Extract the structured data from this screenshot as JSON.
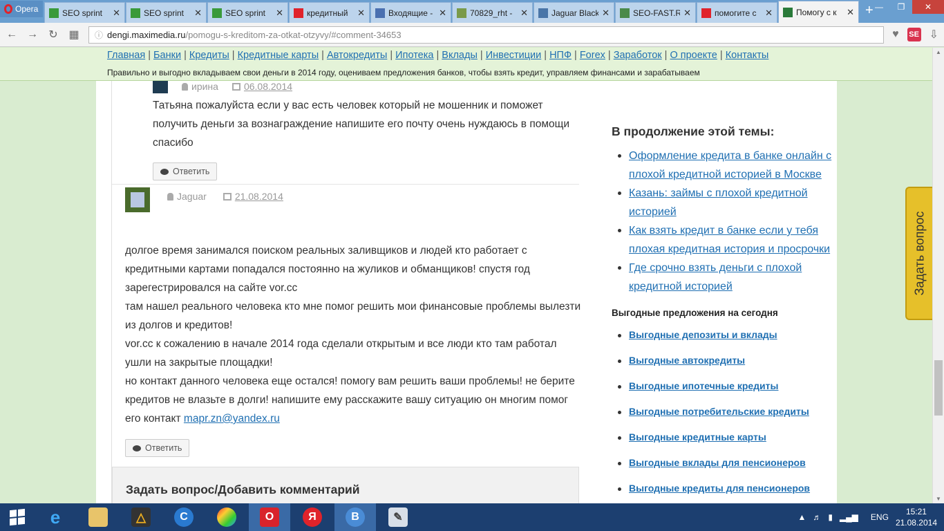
{
  "browser": {
    "menu_label": "Opera",
    "tabs": [
      {
        "title": "SEO sprint",
        "icon": "seosprint-icon",
        "color": "#3a9a3a"
      },
      {
        "title": "SEO sprint",
        "icon": "seosprint-icon",
        "color": "#3a9a3a"
      },
      {
        "title": "SEO sprint",
        "icon": "seosprint-icon",
        "color": "#3a9a3a"
      },
      {
        "title": "кредитный",
        "icon": "yandex-icon",
        "color": "#e0232b"
      },
      {
        "title": "Входящие -",
        "icon": "mail-icon",
        "color": "#4a70b0"
      },
      {
        "title": "70829_rht -",
        "icon": "image-icon",
        "color": "#7a9a4a"
      },
      {
        "title": "Jaguar Black",
        "icon": "vk-icon",
        "color": "#4a76a8"
      },
      {
        "title": "SEO-FAST.R",
        "icon": "seofast-icon",
        "color": "#4a8a4a"
      },
      {
        "title": "помогите с",
        "icon": "yandex-icon",
        "color": "#e0232b"
      },
      {
        "title": "Помогу с к",
        "icon": "page-icon",
        "color": "#2a7a3a"
      }
    ],
    "url_host": "dengi.maximedia.ru",
    "url_path": "/pomogu-s-kreditom-za-otkat-otzyvy/#comment-34653",
    "extension_label": "SE"
  },
  "site": {
    "menu": [
      "Главная",
      "Банки",
      "Кредиты",
      "Кредитные карты",
      "Автокредиты",
      "Ипотека",
      "Вклады",
      "Инвестиции",
      "НПФ",
      "Forex",
      "Заработок",
      "О проекте",
      "Контакты"
    ],
    "tagline": "Правильно и выгодно вкладываем свои деньги в 2014 году, оцениваем предложения банков, чтобы взять кредит, управляем финансами и зарабатываем"
  },
  "comments": {
    "c1": {
      "author": "ирина",
      "date": "06.08.2014",
      "text": "Татьяна пожалуйста если у вас есть человек который не мошенник и поможет получить деньги за вознаграждение напишите его почту очень нуждаюсь в помощи спасибо",
      "reply_label": "Ответить"
    },
    "c2": {
      "author": "Jaguar",
      "date": "21.08.2014",
      "lines": [
        "долгое время занимался поиском реальных заливщиков и людей кто работает с кредитными картами попадался постоянно на жуликов и обманщиков! спустя год зарегестрировался на сайте vor.cc",
        "там нашел реального человека кто мне помог решить мои финансовые проблемы вылезти из долгов и кредитов!",
        "vor.cc к сожалению в начале 2014 года сделали открытым и все люди кто там работал ушли на закрытые площадки!",
        "но контакт данного человека еще остался! помогу вам решить ваши проблемы! не берите кредитов не влазьте в долги! напишите ему расскажите вашу ситуацию он многим помог его контакт"
      ],
      "email": "mapr.zn@yandex.ru",
      "reply_label": "Ответить"
    },
    "ask_title": "Задать вопрос/Добавить комментарий"
  },
  "sidebar": {
    "related_title": "В продолжение этой темы:",
    "related": [
      "Оформление кредита в банке онлайн с плохой кредитной историей в Москве",
      "Казань: займы с плохой кредитной историей",
      "Как взять кредит в банке если у тебя плохая кредитная история и просрочки",
      "Где срочно взять деньги с плохой кредитной историей"
    ],
    "offers_title": "Выгодные предложения на сегодня",
    "offers": [
      "Выгодные депозиты и вклады",
      "Выгодные автокредиты",
      "Выгодные ипотечные кредиты",
      "Выгодные потребительские кредиты",
      "Выгодные кредитные карты",
      "Выгодные вклады для пенсионеров",
      "Выгодные кредиты для пенсионеров"
    ],
    "ask_tab_label": "Задать вопрос"
  },
  "taskbar": {
    "language": "ENG",
    "time": "15:21",
    "date": "21.08.2014"
  },
  "colors": {
    "link": "#1f6fb2",
    "header_bg": "#e4f3d8",
    "ask_tab": "#e6c02a",
    "taskbar": "#1c3f70"
  }
}
